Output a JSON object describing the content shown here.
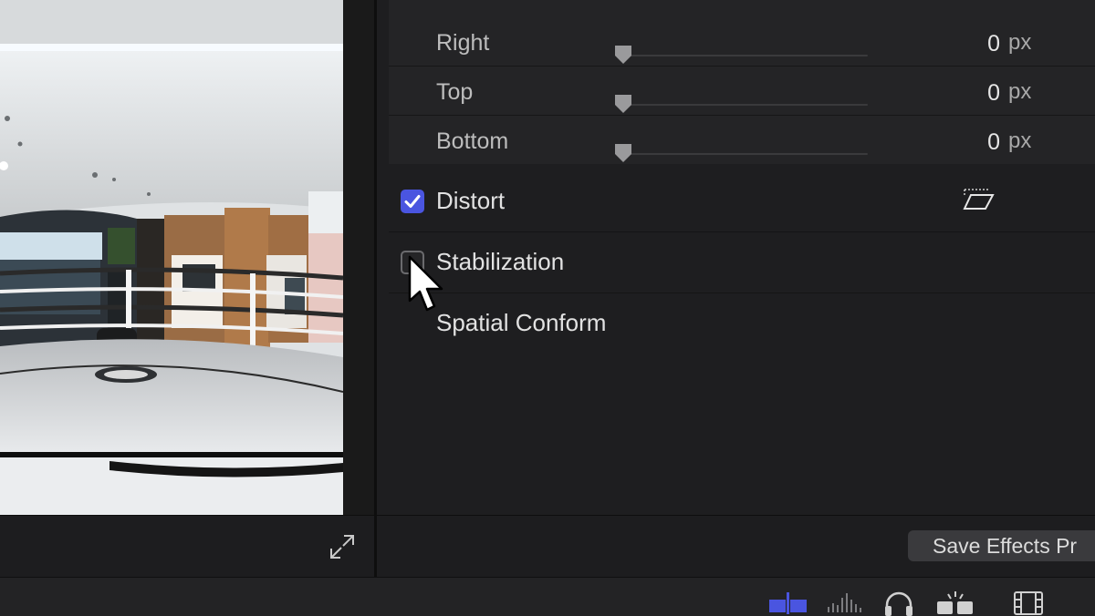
{
  "crop": {
    "rows": [
      {
        "label": "Right",
        "value": "0",
        "unit": "px"
      },
      {
        "label": "Top",
        "value": "0",
        "unit": "px"
      },
      {
        "label": "Bottom",
        "value": "0",
        "unit": "px"
      }
    ]
  },
  "sections": {
    "distort": {
      "label": "Distort",
      "checked": true
    },
    "stabilization": {
      "label": "Stabilization",
      "checked": false
    },
    "spatial_conform": {
      "label": "Spatial Conform"
    }
  },
  "footer": {
    "save_effects_label": "Save Effects Pr"
  },
  "toolbar": {
    "icons": [
      "video-scopes-icon",
      "audio-meters-icon",
      "headphones-icon",
      "effects-browser-icon",
      "filmstrip-icon"
    ]
  },
  "colors": {
    "accent": "#4a55e0",
    "active_toolbar": "#4a55e0"
  }
}
